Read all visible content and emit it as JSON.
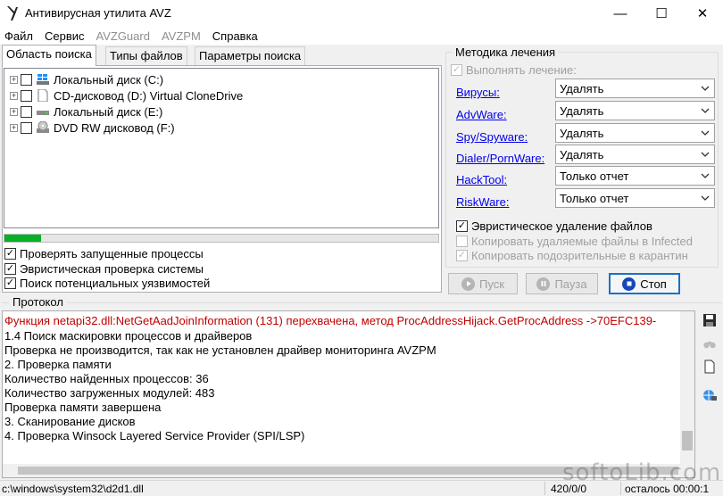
{
  "window": {
    "title": "Антивирусная утилита AVZ",
    "minimize_glyph": "—",
    "maximize_glyph": "☐",
    "close_glyph": "✕"
  },
  "menu": [
    {
      "label": "Файл",
      "enabled": true
    },
    {
      "label": "Сервис",
      "enabled": true
    },
    {
      "label": "AVZGuard",
      "enabled": false
    },
    {
      "label": "AVZPM",
      "enabled": false
    },
    {
      "label": "Справка",
      "enabled": true
    }
  ],
  "tabs": [
    "Область поиска",
    "Типы файлов",
    "Параметры поиска"
  ],
  "drives": [
    {
      "label": "Локальный диск (C:)",
      "icon": "windows-drive-icon",
      "checked": false
    },
    {
      "label": "CD-дисковод (D:) Virtual CloneDrive",
      "icon": "file-icon",
      "checked": false
    },
    {
      "label": "Локальный диск (E:)",
      "icon": "hard-drive-icon",
      "checked": false
    },
    {
      "label": "DVD RW дисковод (F:)",
      "icon": "dvd-drive-icon",
      "checked": false
    }
  ],
  "progress": {
    "fraction": 0.085,
    "color": "#06b025"
  },
  "scan_options": [
    {
      "label": "Проверять запущенные процессы",
      "checked": true
    },
    {
      "label": "Эвристическая проверка системы",
      "checked": true
    },
    {
      "label": "Поиск потенциальных уязвимостей",
      "checked": true
    }
  ],
  "treatment": {
    "title": "Методика лечения",
    "perform_label": "Выполнять лечение:",
    "rows": [
      {
        "link": "Вирусы:",
        "value": "Удалять"
      },
      {
        "link": "AdvWare:",
        "value": "Удалять"
      },
      {
        "link": "Spy/Spyware:",
        "value": "Удалять"
      },
      {
        "link": "Dialer/PornWare:",
        "value": "Удалять"
      },
      {
        "link": "HackTool:",
        "value": "Только отчет"
      },
      {
        "link": "RiskWare:",
        "value": "Только отчет"
      }
    ],
    "options": [
      {
        "label": "Эвристическое удаление файлов",
        "checked": true,
        "enabled": true
      },
      {
        "label": "Копировать удаляемые файлы в  Infected",
        "checked": false,
        "enabled": false
      },
      {
        "label": "Копировать подозрительные в  карантин",
        "checked": true,
        "enabled": false
      }
    ]
  },
  "buttons": {
    "start": "Пуск",
    "pause": "Пауза",
    "stop": "Стоп"
  },
  "protocol": {
    "title": "Протокол",
    "lines": [
      {
        "text": "Функция netapi32.dll:NetGetAadJoinInformation (131) перехвачена, метод ProcAddressHijack.GetProcAddress ->70EFC139-",
        "color": "#c00000"
      },
      {
        "text": "1.4 Поиск маскировки процессов и драйверов"
      },
      {
        "text": " Проверка не производится, так как не установлен драйвер мониторинга AVZPM"
      },
      {
        "text": "2. Проверка памяти"
      },
      {
        "text": " Количество найденных процессов: 36"
      },
      {
        "text": " Количество загруженных модулей: 483"
      },
      {
        "text": "Проверка памяти завершена"
      },
      {
        "text": "3. Сканирование дисков"
      },
      {
        "text": "4. Проверка Winsock Layered Service Provider (SPI/LSP)"
      }
    ]
  },
  "status": {
    "file": "c:\\windows\\system32\\d2d1.dll",
    "count": "420/0/0",
    "remaining": "осталось 00:00:1"
  },
  "watermark": "softoLib.com"
}
